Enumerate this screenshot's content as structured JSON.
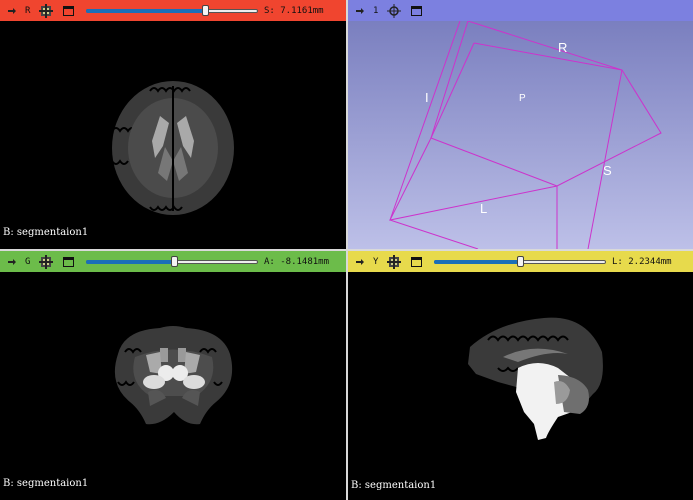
{
  "colors": {
    "red_bar": "#f0452f",
    "blue_bar": "#7c80e0",
    "green_bar": "#6cbc4a",
    "yellow_bar": "#e7da4c",
    "box": "#cc33cc"
  },
  "views": {
    "red": {
      "letter": "R",
      "offset": "S: 7.1161mm",
      "slider_fraction": 0.69,
      "label": "B: segmentaion1"
    },
    "green": {
      "letter": "G",
      "offset": "A: -8.1481mm",
      "slider_fraction": 0.51,
      "label": "B: segmentaion1"
    },
    "yellow": {
      "letter": "Y",
      "offset": "L: 2.2344mm",
      "slider_fraction": 0.5,
      "label": "B: segmentaion1"
    },
    "threed": {
      "letter": "1",
      "axes": {
        "R": "R",
        "I": "I",
        "P": "P",
        "S": "S",
        "L": "L"
      }
    }
  },
  "icons": {
    "pin": "pin-icon",
    "layers": "layers-icon",
    "window": "window-maximize-icon",
    "center": "center-view-icon"
  }
}
